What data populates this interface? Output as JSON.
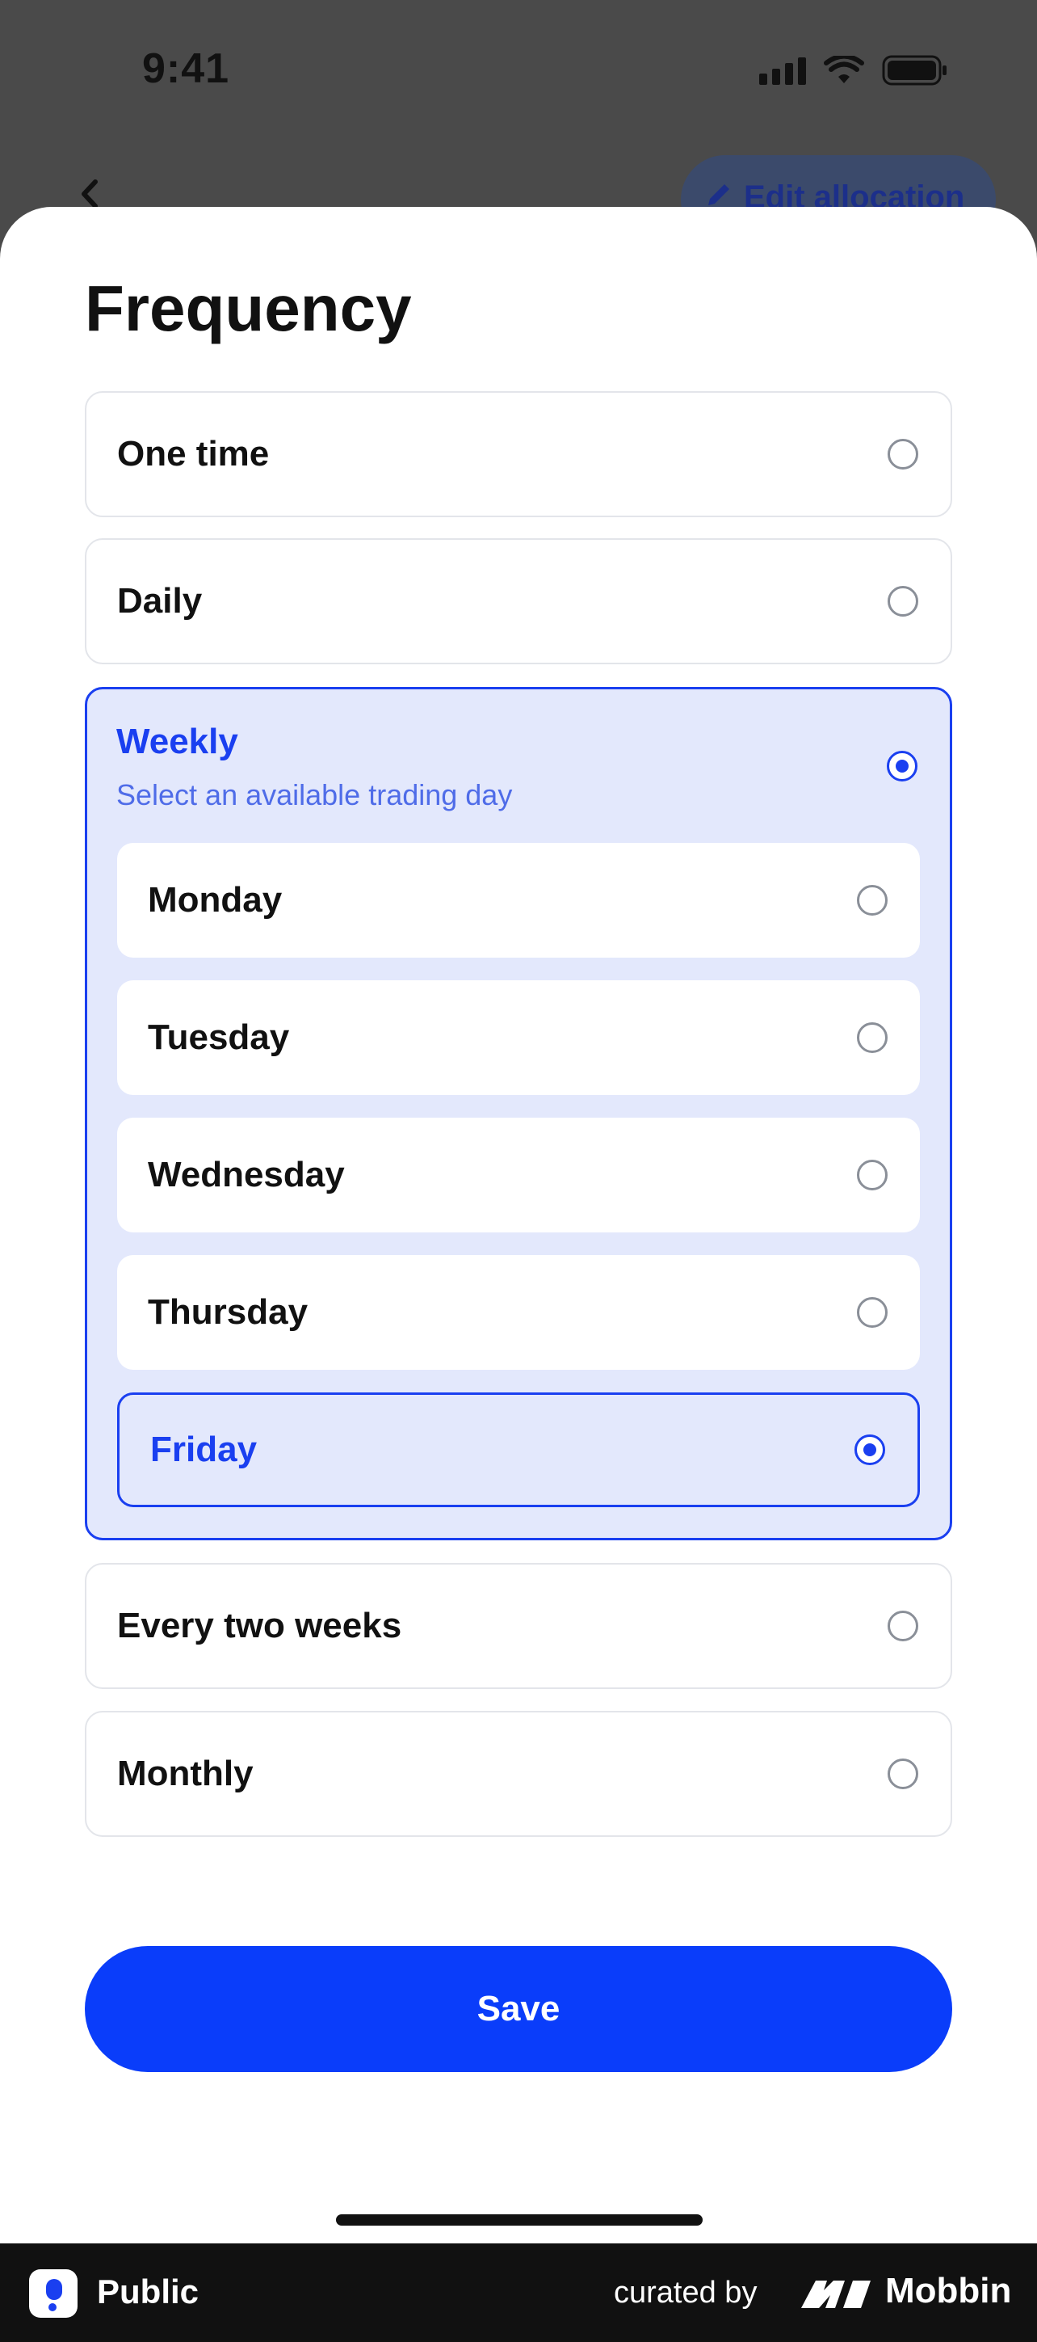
{
  "status_bar": {
    "time": "9:41"
  },
  "background_nav": {
    "edit_label": "Edit allocation"
  },
  "sheet": {
    "title": "Frequency",
    "options": {
      "one_time": "One time",
      "daily": "Daily",
      "weekly": {
        "label": "Weekly",
        "subtitle": "Select an available trading day"
      },
      "every_two_weeks": "Every two weeks",
      "monthly": "Monthly"
    },
    "selected_option": "Weekly",
    "days": [
      "Monday",
      "Tuesday",
      "Wednesday",
      "Thursday",
      "Friday"
    ],
    "selected_day": "Friday",
    "save_label": "Save"
  },
  "footer": {
    "app_name": "Public",
    "curated_by": "curated by",
    "brand": "Mobbin"
  },
  "colors": {
    "accent": "#1a3ff0",
    "save_button": "#0a3dfa",
    "selected_bg": "#e3e8fc"
  },
  "icons": [
    "signal-icon",
    "wifi-icon",
    "battery-icon",
    "back-chevron-icon",
    "pencil-icon",
    "radio-icon",
    "public-logo-icon",
    "mobbin-logo-icon"
  ]
}
